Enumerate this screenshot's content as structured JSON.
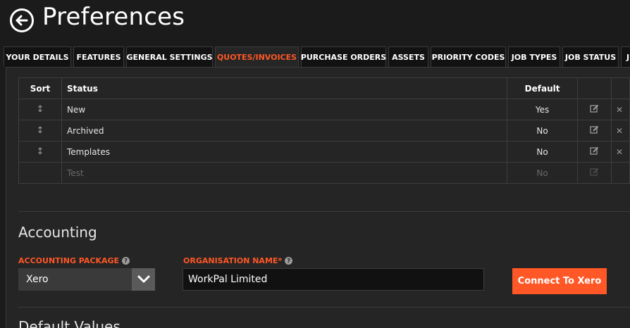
{
  "page": {
    "title": "Preferences"
  },
  "tabs": [
    {
      "label": "YOUR DETAILS"
    },
    {
      "label": "FEATURES"
    },
    {
      "label": "GENERAL SETTINGS"
    },
    {
      "label": "QUOTES/INVOICES",
      "active": true
    },
    {
      "label": "PURCHASE ORDERS"
    },
    {
      "label": "ASSETS"
    },
    {
      "label": "PRIORITY CODES"
    },
    {
      "label": "JOB TYPES"
    },
    {
      "label": "JOB STATUS"
    },
    {
      "label": "J"
    }
  ],
  "status_table": {
    "headers": {
      "sort": "Sort",
      "status": "Status",
      "default": "Default"
    },
    "rows": [
      {
        "status": "New",
        "default": "Yes"
      },
      {
        "status": "Archived",
        "default": "No"
      },
      {
        "status": "Templates",
        "default": "No"
      },
      {
        "status": "Test",
        "default": "No",
        "disabled": true
      }
    ]
  },
  "accounting": {
    "title": "Accounting",
    "package_label": "ACCOUNTING PACKAGE",
    "package_value": "Xero",
    "org_label": "ORGANISATION NAME*",
    "org_value": "WorkPal Limited",
    "connect_label": "Connect To Xero"
  },
  "default_values": {
    "title": "Default Values"
  },
  "icons": {
    "back": "arrow-left-circle-icon",
    "help": "question-circle-icon",
    "sort": "sort-arrows-icon",
    "edit": "edit-pencil-icon",
    "delete": "close-x-icon",
    "dropdown": "chevron-down-icon"
  },
  "colors": {
    "accent": "#ff5726",
    "background": "#1b1b1b",
    "panel": "#252525"
  }
}
